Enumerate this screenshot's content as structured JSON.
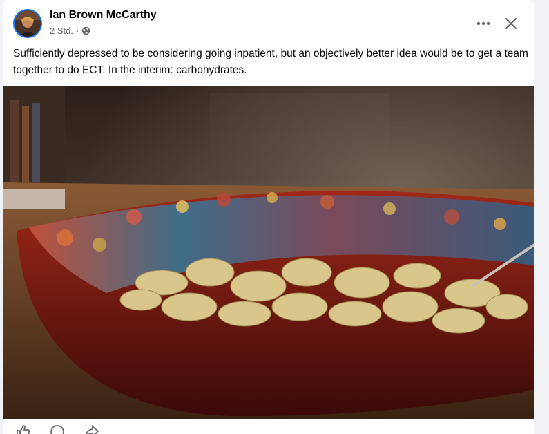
{
  "post": {
    "author": "Ian Brown McCarthy",
    "time": "2 Std.",
    "separator": "·",
    "privacy_icon": "globe-icon",
    "text": "Sufficiently depressed to be considering going inpatient, but an objectively better idea would be to get a team together to do ECT. In the interim: carbohydrates."
  },
  "header_actions": {
    "more_icon": "more-options-icon",
    "close_icon": "close-icon"
  },
  "photo": {
    "subject_icon": "pasta-bowl-photo"
  },
  "footer_actions": [
    "like-icon",
    "comment-icon",
    "share-icon"
  ]
}
